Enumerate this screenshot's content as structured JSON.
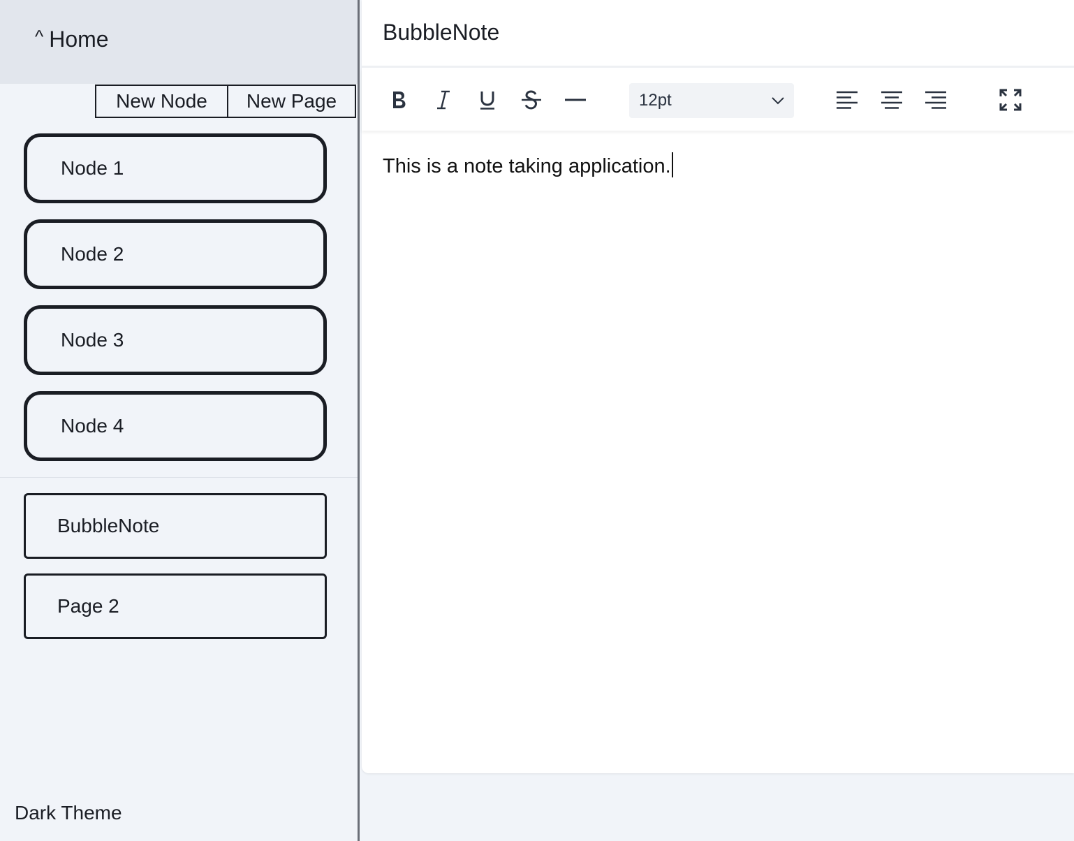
{
  "sidebar": {
    "home_label": "Home",
    "new_node_label": "New Node",
    "new_page_label": "New Page",
    "nodes": [
      {
        "label": "Node 1"
      },
      {
        "label": "Node 2"
      },
      {
        "label": "Node 3"
      },
      {
        "label": "Node 4"
      }
    ],
    "pages": [
      {
        "label": "BubbleNote"
      },
      {
        "label": "Page 2"
      }
    ],
    "theme_toggle_label": "Dark Theme"
  },
  "editor": {
    "title": "BubbleNote",
    "font_size": "12pt",
    "content": "This is a note taking application.",
    "toolbar_icons": [
      "bold-icon",
      "italic-icon",
      "underline-icon",
      "strikethrough-icon",
      "horizontal-rule-icon",
      "align-left-icon",
      "align-center-icon",
      "align-right-icon",
      "fullscreen-icon"
    ]
  }
}
